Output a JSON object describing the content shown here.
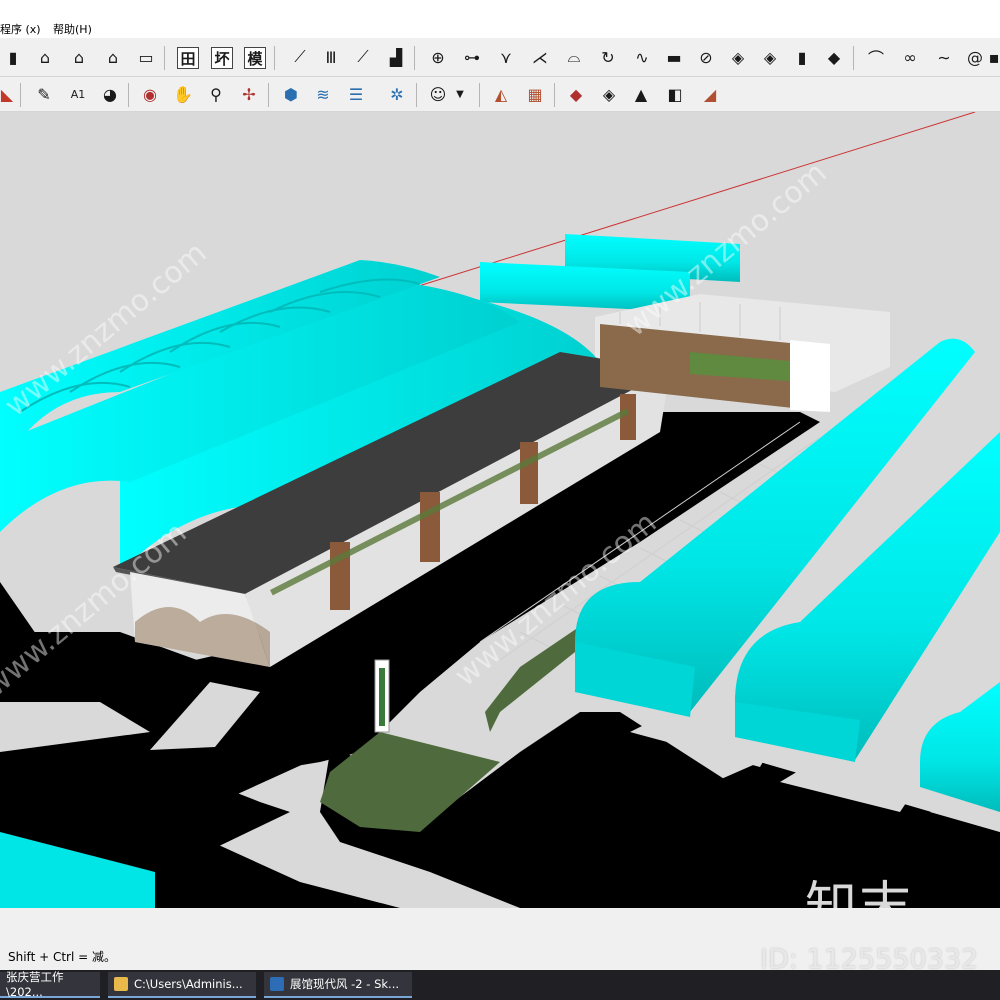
{
  "menubar": {
    "items": [
      {
        "label": "程序 (x)"
      },
      {
        "label": "帮助(H)"
      }
    ]
  },
  "toolbar1": {
    "text_buttons": [
      "田",
      "坏",
      "模"
    ]
  },
  "viewport": {
    "brand_watermark": "知末",
    "diag_watermark": "www.znzmo.com",
    "colors": {
      "sky": "#d9d9d9",
      "road": "#000000",
      "greenhouse_cyan": "#00e6e6",
      "roof": "#3d3d3d",
      "lawn": "#4f6b3d",
      "axis_red": "#cc3333"
    }
  },
  "statusbar": {
    "message": "Shift + Ctrl = 减。",
    "id_label": "ID: 1125550332"
  },
  "taskbar": {
    "items": [
      {
        "label": "张庆营工作\\202...",
        "icon": "folder-icon"
      },
      {
        "label": "C:\\Users\\Adminis...",
        "icon": "folder-icon"
      },
      {
        "label": "展馆现代风 -2 - Sk...",
        "icon": "sketchup-icon"
      }
    ]
  }
}
